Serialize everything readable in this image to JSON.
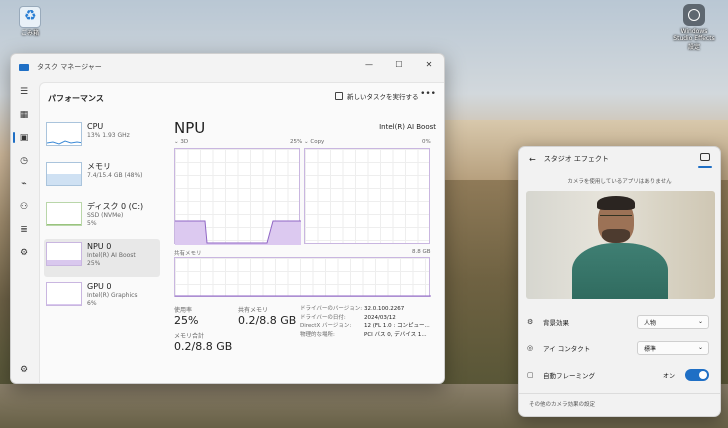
{
  "desktop": {
    "recycle_label": "ごみ箱",
    "shortcut_label_1": "Windows Studio Effects",
    "shortcut_label_2": "設定"
  },
  "taskmanager": {
    "title": "タスク マネージャー",
    "controls": {
      "min": "—",
      "max": "☐",
      "close": "✕"
    },
    "section": "パフォーマンス",
    "run_task": "新しいタスクを実行する",
    "more": "•••",
    "devices": [
      {
        "name": "CPU",
        "line1": "13% 1.93 GHz",
        "line2": ""
      },
      {
        "name": "メモリ",
        "line1": "7.4/15.4 GB (48%)",
        "line2": ""
      },
      {
        "name": "ディスク 0 (C:)",
        "line1": "SSD (NVMe)",
        "line2": "5%"
      },
      {
        "name": "NPU 0",
        "line1": "Intel(R) AI Boost",
        "line2": "25%"
      },
      {
        "name": "GPU 0",
        "line1": "Intel(R) Graphics",
        "line2": "6%"
      }
    ],
    "detail": {
      "title": "NPU",
      "model": "Intel(R) AI Boost",
      "graph1_label": "3D",
      "graph1_pct": "25%",
      "graph2_label": "Copy",
      "graph2_pct": "0%",
      "shared_label": "共有メモリ",
      "shared_max": "8.8 GB",
      "usage_label": "使用率",
      "usage_value": "25%",
      "shared_mem_label": "共有メモリ",
      "shared_mem_value": "0.2/8.8 GB",
      "mem_total_label": "メモリ合計",
      "mem_total_value": "0.2/8.8 GB",
      "driver_version_label": "ドライバーのバージョン:",
      "driver_version": "32.0.100.2267",
      "driver_date_label": "ドライバーの日付:",
      "driver_date": "2024/03/12",
      "directx_label": "DirectX バージョン:",
      "directx": "12 (FL 1.0 : コンピュー...",
      "location_label": "物理的な場所:",
      "location": "PCI バス 0, デバイス 1..."
    }
  },
  "studio": {
    "title": "スタジオ エフェクト",
    "back": "←",
    "note": "カメラを使用しているアプリはありません",
    "bg_label": "背景効果",
    "bg_value": "人物",
    "eye_label": "アイ コンタクト",
    "eye_value": "標準",
    "frame_label": "自動フレーミング",
    "frame_state": "オン",
    "footer": "その他のカメラ効果の設定"
  }
}
